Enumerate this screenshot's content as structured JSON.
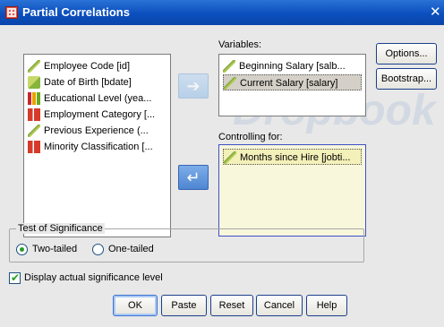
{
  "window": {
    "title": "Partial Correlations",
    "close_glyph": "✕"
  },
  "watermark": "Dropbook",
  "source_list": {
    "items": [
      {
        "label": "Employee Code [id]",
        "icon": "ruler-icon"
      },
      {
        "label": "Date of Birth [bdate]",
        "icon": "date-icon"
      },
      {
        "label": "Educational Level (yea...",
        "icon": "ordinal-bars-icon"
      },
      {
        "label": "Employment Category [...",
        "icon": "nominal-bars-icon"
      },
      {
        "label": "Previous Experience (...",
        "icon": "ruler-icon"
      },
      {
        "label": "Minority Classification [...",
        "icon": "nominal-bars-icon"
      }
    ]
  },
  "variables": {
    "label": "Variables:",
    "items": [
      {
        "label": "Beginning Salary [salb...",
        "icon": "ruler-icon",
        "selected": false
      },
      {
        "label": "Current Salary [salary]",
        "icon": "ruler-icon",
        "selected": true
      }
    ]
  },
  "controlling": {
    "label": "Controlling for:",
    "items": [
      {
        "label": "Months since Hire [jobti...",
        "icon": "ruler-icon",
        "selected": true
      }
    ]
  },
  "side_buttons": {
    "options": "Options...",
    "bootstrap": "Bootstrap..."
  },
  "significance": {
    "legend": "Test of Significance",
    "two_tailed": "Two-tailed",
    "one_tailed": "One-tailed",
    "selected": "two_tailed"
  },
  "display_actual": {
    "label": "Display actual significance level",
    "checked": true
  },
  "footer_buttons": {
    "ok": "OK",
    "paste": "Paste",
    "reset": "Reset",
    "cancel": "Cancel",
    "help": "Help"
  },
  "arrows": {
    "move_to_variables": "➔",
    "move_to_controlling": "↵"
  }
}
